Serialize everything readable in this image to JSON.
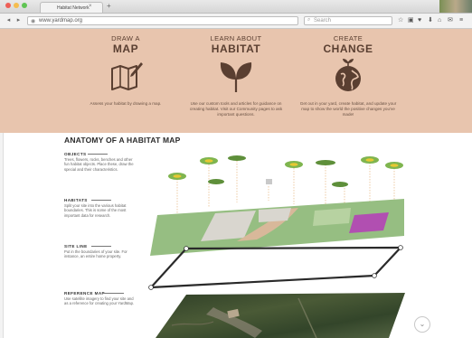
{
  "browser": {
    "tab_title": "Habitat Network",
    "url": "www.yardmap.org",
    "search_placeholder": "Search",
    "new_tab": "+",
    "close": "×",
    "back": "◂",
    "forward": "▸",
    "reload": "↻",
    "toolbar_icons": [
      "☆",
      "▣",
      "♥",
      "⬇",
      "⌂",
      "✉",
      "≡"
    ]
  },
  "hero": {
    "columns": [
      {
        "pre": "DRAW A",
        "big": "MAP",
        "icon": "map-pencil-icon",
        "desc": "Assess your habitat by drawing a map."
      },
      {
        "pre": "LEARN ABOUT",
        "big": "HABITAT",
        "icon": "leaf-sprout-icon",
        "desc": "Use our custom tools and articles for guidance on creating habitat. Visit our Community pages to ask important questions."
      },
      {
        "pre": "CREATE",
        "big": "CHANGE",
        "icon": "globe-sprout-icon",
        "desc": "Get out in your yard, create habitat, and update your map to show the world the positive changes you've made!"
      }
    ],
    "color": "#e8c5ae"
  },
  "anatomy": {
    "title": "ANATOMY OF A HABITAT MAP",
    "layers": [
      {
        "heading": "OBJECTS",
        "text": "Trees, flowers, rocks, benches and other fun habitat objects. Place these, draw the special and their characteristics."
      },
      {
        "heading": "HABITATS",
        "text": "Split your site into the various habitat boundaries. This is some of the most important data for research."
      },
      {
        "heading": "SITE LINE",
        "text": "Put in the boundaries of your site. For instance, an entire home property."
      },
      {
        "heading": "REFERENCE MAP",
        "text": "Use satellite imagery to find your site and as a reference for creating your YardMap."
      }
    ]
  },
  "scroll_down": "⌄"
}
